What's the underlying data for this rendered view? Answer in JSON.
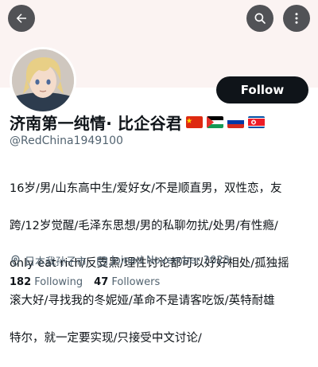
{
  "header": {
    "back_icon": "arrow-left-icon",
    "search_icon": "search-icon",
    "more_icon": "more-vertical-icon",
    "banner_color": "#fbf3f2"
  },
  "profile": {
    "display_name": "济南第一纯情· 比企谷君",
    "flags": [
      "china-flag",
      "palestine-flag",
      "russia-flag",
      "north-korea-flag"
    ],
    "handle": "@RedChina1949100",
    "follow_label": "Follow",
    "bio_lines": [
      "16岁/男/山东高中生/爱好女/不是顺直男，双性恋，友",
      "跨/12岁觉醒/毛泽东思想/男的私聊勿扰/处男/有性瘾/",
      "only eat rich/反支黑/理性讨论都可以好好相处/孤独摇",
      "滚大好/寻找我的冬妮娅/革命不是请客吃饭/英特耐雄",
      "特尔，就一定要实现/只接受中文讨论/"
    ],
    "location": "日本我孙子市",
    "joined": "Joined November 2023",
    "following_count": "182",
    "following_label": "Following",
    "followers_count": "47",
    "followers_label": "Followers"
  }
}
